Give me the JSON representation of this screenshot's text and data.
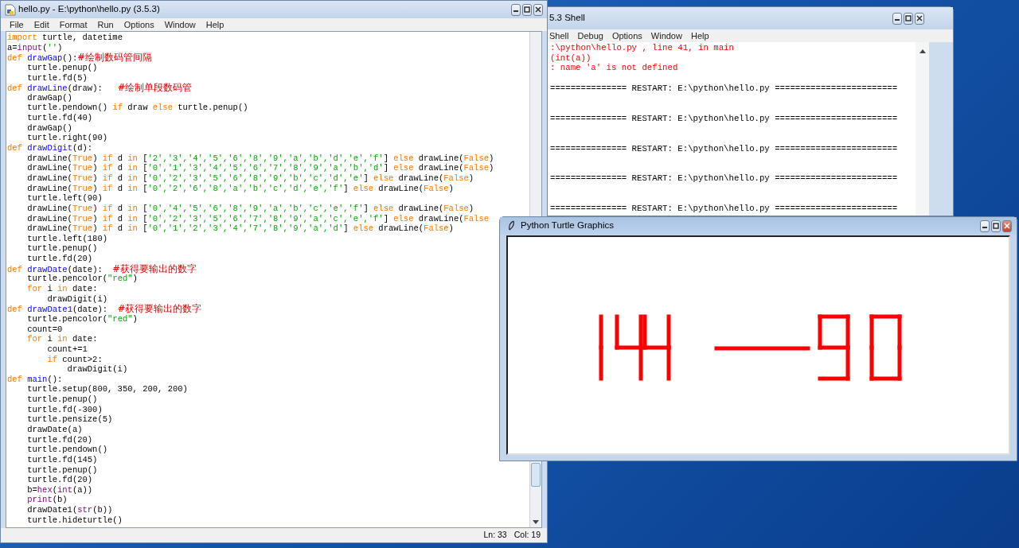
{
  "editor": {
    "title": "hello.py - E:\\python\\hello.py (3.5.3)",
    "menu": [
      "File",
      "Edit",
      "Format",
      "Run",
      "Options",
      "Window",
      "Help"
    ],
    "lines": [
      [
        {
          "kind": "keyword",
          "text": "import"
        },
        {
          "kind": "plain",
          "text": " turtle, datetime"
        }
      ],
      [
        {
          "kind": "plain",
          "text": "a="
        },
        {
          "kind": "builtin",
          "text": "input"
        },
        {
          "kind": "plain",
          "text": "("
        },
        {
          "kind": "string",
          "text": "''"
        },
        {
          "kind": "plain",
          "text": ")"
        }
      ],
      [
        {
          "kind": "keyword",
          "text": "def "
        },
        {
          "kind": "defname",
          "text": "drawGap"
        },
        {
          "kind": "plain",
          "text": "():"
        },
        {
          "kind": "comment",
          "text": "#绘制数码管间隔"
        }
      ],
      [
        {
          "kind": "plain",
          "text": "    turtle.penup()"
        }
      ],
      [
        {
          "kind": "plain",
          "text": "    turtle.fd(5)"
        }
      ],
      [
        {
          "kind": "keyword",
          "text": "def "
        },
        {
          "kind": "defname",
          "text": "drawLine"
        },
        {
          "kind": "plain",
          "text": "(draw):   "
        },
        {
          "kind": "comment",
          "text": "#绘制单段数码管"
        }
      ],
      [
        {
          "kind": "plain",
          "text": "    drawGap()"
        }
      ],
      [
        {
          "kind": "plain",
          "text": "    turtle.pendown() "
        },
        {
          "kind": "keyword",
          "text": "if"
        },
        {
          "kind": "plain",
          "text": " draw "
        },
        {
          "kind": "keyword",
          "text": "else"
        },
        {
          "kind": "plain",
          "text": " turtle.penup()"
        }
      ],
      [
        {
          "kind": "plain",
          "text": "    turtle.fd(40)"
        }
      ],
      [
        {
          "kind": "plain",
          "text": "    drawGap()"
        }
      ],
      [
        {
          "kind": "plain",
          "text": "    turtle.right(90)"
        }
      ],
      [
        {
          "kind": "keyword",
          "text": "def "
        },
        {
          "kind": "defname",
          "text": "drawDigit"
        },
        {
          "kind": "plain",
          "text": "(d):"
        }
      ],
      [
        {
          "kind": "plain",
          "text": "    drawLine("
        },
        {
          "kind": "keyword",
          "text": "True"
        },
        {
          "kind": "plain",
          "text": ") "
        },
        {
          "kind": "keyword",
          "text": "if"
        },
        {
          "kind": "plain",
          "text": " d "
        },
        {
          "kind": "keyword",
          "text": "in"
        },
        {
          "kind": "plain",
          "text": " ["
        },
        {
          "kind": "string",
          "text": "'2','3','4','5','6','8','9','a','b','d','e','f'"
        },
        {
          "kind": "plain",
          "text": "] "
        },
        {
          "kind": "keyword",
          "text": "else"
        },
        {
          "kind": "plain",
          "text": " drawLine("
        },
        {
          "kind": "keyword",
          "text": "False"
        },
        {
          "kind": "plain",
          "text": ")"
        }
      ],
      [
        {
          "kind": "plain",
          "text": "    drawLine("
        },
        {
          "kind": "keyword",
          "text": "True"
        },
        {
          "kind": "plain",
          "text": ") "
        },
        {
          "kind": "keyword",
          "text": "if"
        },
        {
          "kind": "plain",
          "text": " d "
        },
        {
          "kind": "keyword",
          "text": "in"
        },
        {
          "kind": "plain",
          "text": " ["
        },
        {
          "kind": "string",
          "text": "'0','1','3','4','5','6','7','8','9','a','b','d'"
        },
        {
          "kind": "plain",
          "text": "] "
        },
        {
          "kind": "keyword",
          "text": "else"
        },
        {
          "kind": "plain",
          "text": " drawLine("
        },
        {
          "kind": "keyword",
          "text": "False"
        },
        {
          "kind": "plain",
          "text": ")"
        }
      ],
      [
        {
          "kind": "plain",
          "text": "    drawLine("
        },
        {
          "kind": "keyword",
          "text": "True"
        },
        {
          "kind": "plain",
          "text": ") "
        },
        {
          "kind": "keyword",
          "text": "if"
        },
        {
          "kind": "plain",
          "text": " d "
        },
        {
          "kind": "keyword",
          "text": "in"
        },
        {
          "kind": "plain",
          "text": " ["
        },
        {
          "kind": "string",
          "text": "'0','2','3','5','6','8','9','b','c','d','e'"
        },
        {
          "kind": "plain",
          "text": "] "
        },
        {
          "kind": "keyword",
          "text": "else"
        },
        {
          "kind": "plain",
          "text": " drawLine("
        },
        {
          "kind": "keyword",
          "text": "False"
        },
        {
          "kind": "plain",
          "text": ")"
        }
      ],
      [
        {
          "kind": "plain",
          "text": "    drawLine("
        },
        {
          "kind": "keyword",
          "text": "True"
        },
        {
          "kind": "plain",
          "text": ") "
        },
        {
          "kind": "keyword",
          "text": "if"
        },
        {
          "kind": "plain",
          "text": " d "
        },
        {
          "kind": "keyword",
          "text": "in"
        },
        {
          "kind": "plain",
          "text": " ["
        },
        {
          "kind": "string",
          "text": "'0','2','6','8','a','b','c','d','e','f'"
        },
        {
          "kind": "plain",
          "text": "] "
        },
        {
          "kind": "keyword",
          "text": "else"
        },
        {
          "kind": "plain",
          "text": " drawLine("
        },
        {
          "kind": "keyword",
          "text": "False"
        },
        {
          "kind": "plain",
          "text": ")"
        }
      ],
      [
        {
          "kind": "plain",
          "text": "    turtle.left(90)"
        }
      ],
      [
        {
          "kind": "plain",
          "text": "    drawLine("
        },
        {
          "kind": "keyword",
          "text": "True"
        },
        {
          "kind": "plain",
          "text": ") "
        },
        {
          "kind": "keyword",
          "text": "if"
        },
        {
          "kind": "plain",
          "text": " d "
        },
        {
          "kind": "keyword",
          "text": "in"
        },
        {
          "kind": "plain",
          "text": " ["
        },
        {
          "kind": "string",
          "text": "'0','4','5','6','8','9','a','b','c','e','f'"
        },
        {
          "kind": "plain",
          "text": "] "
        },
        {
          "kind": "keyword",
          "text": "else"
        },
        {
          "kind": "plain",
          "text": " drawLine("
        },
        {
          "kind": "keyword",
          "text": "False"
        },
        {
          "kind": "plain",
          "text": ")"
        }
      ],
      [
        {
          "kind": "plain",
          "text": "    drawLine("
        },
        {
          "kind": "keyword",
          "text": "True"
        },
        {
          "kind": "plain",
          "text": ") "
        },
        {
          "kind": "keyword",
          "text": "if"
        },
        {
          "kind": "plain",
          "text": " d "
        },
        {
          "kind": "keyword",
          "text": "in"
        },
        {
          "kind": "plain",
          "text": " ["
        },
        {
          "kind": "string",
          "text": "'0','2','3','5','6','7','8','9','a','c','e','f'"
        },
        {
          "kind": "plain",
          "text": "] "
        },
        {
          "kind": "keyword",
          "text": "else"
        },
        {
          "kind": "plain",
          "text": " drawLine("
        },
        {
          "kind": "keyword",
          "text": "False"
        }
      ],
      [
        {
          "kind": "plain",
          "text": "    drawLine("
        },
        {
          "kind": "keyword",
          "text": "True"
        },
        {
          "kind": "plain",
          "text": ") "
        },
        {
          "kind": "keyword",
          "text": "if"
        },
        {
          "kind": "plain",
          "text": " d "
        },
        {
          "kind": "keyword",
          "text": "in"
        },
        {
          "kind": "plain",
          "text": " ["
        },
        {
          "kind": "string",
          "text": "'0','1','2','3','4','7','8','9','a','d'"
        },
        {
          "kind": "plain",
          "text": "] "
        },
        {
          "kind": "keyword",
          "text": "else"
        },
        {
          "kind": "plain",
          "text": " drawLine("
        },
        {
          "kind": "keyword",
          "text": "False"
        },
        {
          "kind": "plain",
          "text": ")"
        }
      ],
      [
        {
          "kind": "plain",
          "text": "    turtle.left(180)"
        }
      ],
      [
        {
          "kind": "plain",
          "text": "    turtle.penup()"
        }
      ],
      [
        {
          "kind": "plain",
          "text": "    turtle.fd(20)"
        }
      ],
      [
        {
          "kind": "keyword",
          "text": "def "
        },
        {
          "kind": "defname",
          "text": "drawDate"
        },
        {
          "kind": "plain",
          "text": "(date):  "
        },
        {
          "kind": "comment",
          "text": "#获得要输出的数字"
        }
      ],
      [
        {
          "kind": "plain",
          "text": "    turtle.pencolor("
        },
        {
          "kind": "string",
          "text": "\"red\""
        },
        {
          "kind": "plain",
          "text": ")"
        }
      ],
      [
        {
          "kind": "keyword",
          "text": "    for"
        },
        {
          "kind": "plain",
          "text": " i "
        },
        {
          "kind": "keyword",
          "text": "in"
        },
        {
          "kind": "plain",
          "text": " date:"
        }
      ],
      [
        {
          "kind": "plain",
          "text": "        drawDigit(i)"
        }
      ],
      [
        {
          "kind": "keyword",
          "text": "def "
        },
        {
          "kind": "defname",
          "text": "drawDate1"
        },
        {
          "kind": "plain",
          "text": "(date):  "
        },
        {
          "kind": "comment",
          "text": "#获得要输出的数字"
        }
      ],
      [
        {
          "kind": "plain",
          "text": "    turtle.pencolor("
        },
        {
          "kind": "string",
          "text": "\"red\""
        },
        {
          "kind": "plain",
          "text": ")"
        }
      ],
      [
        {
          "kind": "plain",
          "text": "    count=0"
        }
      ],
      [
        {
          "kind": "keyword",
          "text": "    for"
        },
        {
          "kind": "plain",
          "text": " i "
        },
        {
          "kind": "keyword",
          "text": "in"
        },
        {
          "kind": "plain",
          "text": " date:"
        }
      ],
      [
        {
          "kind": "plain",
          "text": "        count+=1"
        }
      ],
      [
        {
          "kind": "keyword",
          "text": "        if"
        },
        {
          "kind": "plain",
          "text": " count>2:"
        }
      ],
      [
        {
          "kind": "plain",
          "text": "            drawDigit(i)"
        }
      ],
      [
        {
          "kind": "keyword",
          "text": "def "
        },
        {
          "kind": "defname",
          "text": "main"
        },
        {
          "kind": "plain",
          "text": "():"
        }
      ],
      [
        {
          "kind": "plain",
          "text": "    turtle.setup(800, 350, 200, 200)"
        }
      ],
      [
        {
          "kind": "plain",
          "text": "    turtle.penup()"
        }
      ],
      [
        {
          "kind": "plain",
          "text": "    turtle.fd(-300)"
        }
      ],
      [
        {
          "kind": "plain",
          "text": "    turtle.pensize(5)"
        }
      ],
      [
        {
          "kind": "plain",
          "text": "    drawDate(a)"
        }
      ],
      [
        {
          "kind": "plain",
          "text": "    turtle.fd(20)"
        }
      ],
      [
        {
          "kind": "plain",
          "text": "    turtle.pendown()"
        }
      ],
      [
        {
          "kind": "plain",
          "text": "    turtle.fd(145)"
        }
      ],
      [
        {
          "kind": "plain",
          "text": "    turtle.penup()"
        }
      ],
      [
        {
          "kind": "plain",
          "text": "    turtle.fd(20)"
        }
      ],
      [
        {
          "kind": "plain",
          "text": "    b="
        },
        {
          "kind": "builtin",
          "text": "hex"
        },
        {
          "kind": "plain",
          "text": "("
        },
        {
          "kind": "builtin",
          "text": "int"
        },
        {
          "kind": "plain",
          "text": "(a))"
        }
      ],
      [
        {
          "kind": "builtin",
          "text": "    print"
        },
        {
          "kind": "plain",
          "text": "(b)"
        }
      ],
      [
        {
          "kind": "plain",
          "text": "    drawDate1("
        },
        {
          "kind": "builtin",
          "text": "str"
        },
        {
          "kind": "plain",
          "text": "(b))"
        }
      ],
      [
        {
          "kind": "plain",
          "text": "    turtle.hideturtle()"
        }
      ]
    ],
    "status": {
      "line": "Ln: 33",
      "column": "Col: 19"
    }
  },
  "shell": {
    "title": "5.3 Shell",
    "menu": [
      "Shell",
      "Debug",
      "Options",
      "Window",
      "Help"
    ],
    "lines": [
      {
        "kind": "error",
        "text": ":\\python\\hello.py , line 41, in main"
      },
      {
        "kind": "error",
        "text": "(int(a))"
      },
      {
        "kind": "error",
        "text": ": name 'a' is not defined"
      },
      {
        "kind": "restart",
        "text": "=============== RESTART: E:\\python\\hello.py ========================"
      },
      {
        "kind": "restart",
        "text": "=============== RESTART: E:\\python\\hello.py ========================"
      },
      {
        "kind": "restart",
        "text": "=============== RESTART: E:\\python\\hello.py ========================"
      },
      {
        "kind": "restart",
        "text": "=============== RESTART: E:\\python\\hello.py ========================"
      },
      {
        "kind": "restart",
        "text": "=============== RESTART: E:\\python\\hello.py ========================"
      }
    ]
  },
  "turtle": {
    "title": "Python Turtle Graphics"
  }
}
